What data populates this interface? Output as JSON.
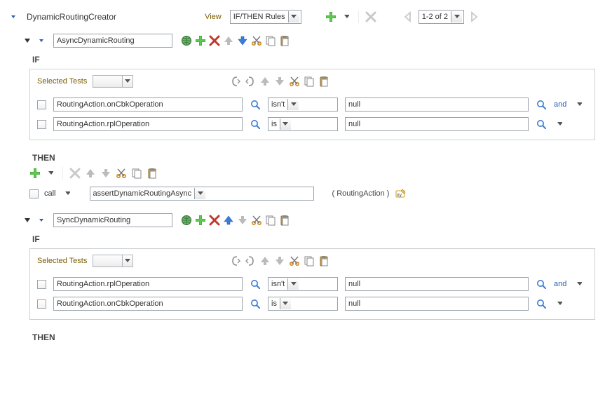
{
  "header": {
    "title": "DynamicRoutingCreator",
    "viewLabel": "View",
    "viewValue": "IF/THEN Rules",
    "pager": "1-2 of 2"
  },
  "rules": [
    {
      "name": "AsyncDynamicRouting",
      "if": {
        "selectedTestsLabel": "Selected Tests",
        "rows": [
          {
            "field": "RoutingAction.onCbkOperation",
            "op": "isn't",
            "val": "null",
            "trail": "and"
          },
          {
            "field": "RoutingAction.rplOperation",
            "op": "is",
            "val": "null",
            "trail": ""
          }
        ]
      },
      "then": {
        "callLabel": "call",
        "action": "assertDynamicRoutingAsync",
        "param": "( RoutingAction )"
      }
    },
    {
      "name": "SyncDynamicRouting",
      "if": {
        "selectedTestsLabel": "Selected Tests",
        "rows": [
          {
            "field": "RoutingAction.rplOperation",
            "op": "isn't",
            "val": "null",
            "trail": "and"
          },
          {
            "field": "RoutingAction.onCbkOperation",
            "op": "is",
            "val": "null",
            "trail": ""
          }
        ]
      }
    }
  ],
  "labels": {
    "if": "IF",
    "then": "THEN"
  }
}
